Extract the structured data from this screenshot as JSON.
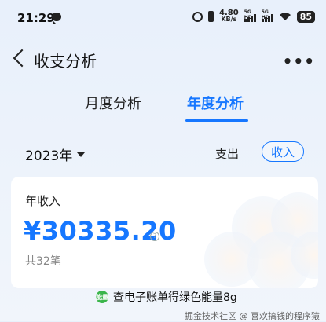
{
  "status_bar": {
    "time": "21:29",
    "net_speed_value": "4.80",
    "net_speed_unit": "KB/s",
    "signal1_label": "5G HD",
    "signal2_label": "5G HD",
    "battery": "85"
  },
  "header": {
    "title": "收支分析"
  },
  "tabs": [
    {
      "label": "月度分析",
      "active": false
    },
    {
      "label": "年度分析",
      "active": true
    }
  ],
  "filter": {
    "year": "2023年",
    "expense_label": "支出",
    "income_label": "收入"
  },
  "card": {
    "label": "年收入",
    "amount": "¥30335.20",
    "count": "共32笔"
  },
  "banner": {
    "icon_text": "能量",
    "text": "查电子账单得绿色能量8g"
  },
  "watermark": "掘金技术社区 @ 喜欢搞钱的程序猿",
  "colors": {
    "accent": "#1677ff",
    "energy": "#3ab54a"
  }
}
